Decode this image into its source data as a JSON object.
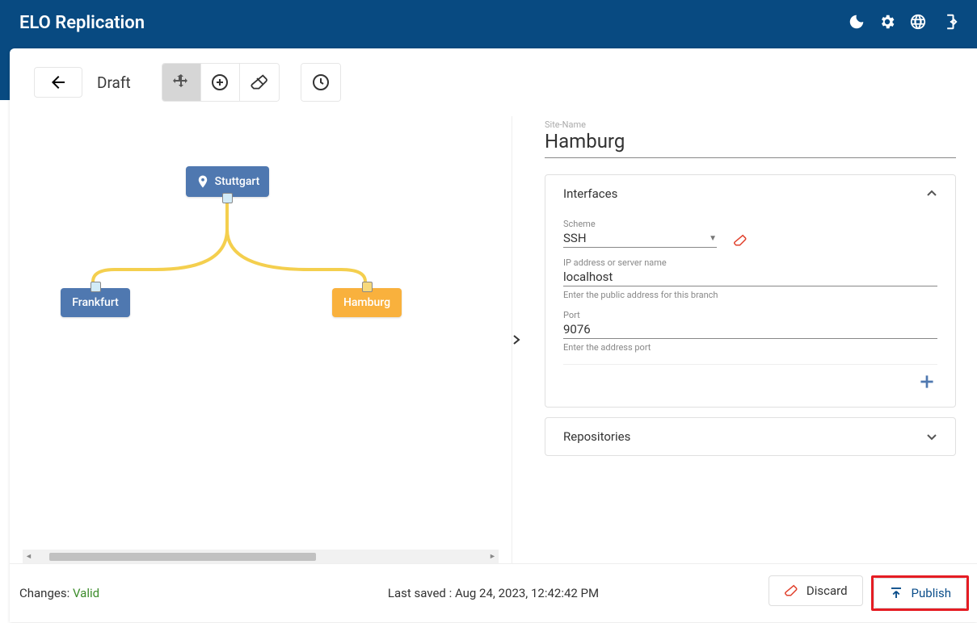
{
  "header": {
    "title": "ELO Replication"
  },
  "toolbar": {
    "status_label": "Draft"
  },
  "canvas": {
    "nodes": {
      "stuttgart": "Stuttgart",
      "frankfurt": "Frankfurt",
      "hamburg": "Hamburg"
    }
  },
  "detail": {
    "site_label": "Site-Name",
    "site_name": "Hamburg",
    "interfaces": {
      "title": "Interfaces",
      "scheme_label": "Scheme",
      "scheme_value": "SSH",
      "ip_label": "IP address or server name",
      "ip_value": "localhost",
      "ip_hint": "Enter the public address for this branch",
      "port_label": "Port",
      "port_value": "9076",
      "port_hint": "Enter the address port"
    },
    "repositories": {
      "title": "Repositories"
    }
  },
  "footer": {
    "changes_label": "Changes: ",
    "changes_status": "Valid",
    "last_saved_label": "Last saved : ",
    "last_saved_value": "Aug 24, 2023, 12:42:42 PM",
    "discard_label": "Discard",
    "publish_label": "Publish"
  }
}
